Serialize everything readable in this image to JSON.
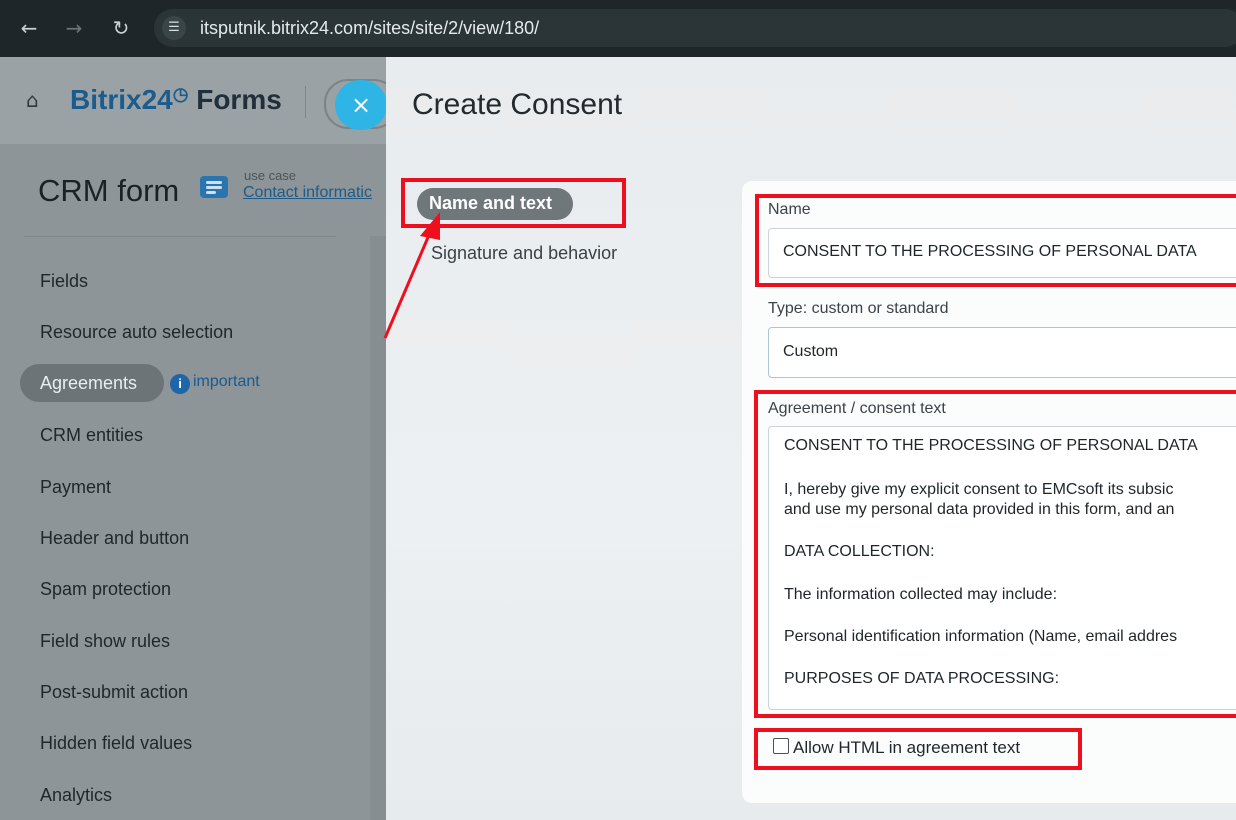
{
  "browser": {
    "back_icon": "arrow-left-icon",
    "forward_icon": "arrow-right-icon",
    "reload_icon": "reload-icon",
    "url": "itsputnik.bitrix24.com/sites/site/2/view/180/"
  },
  "app": {
    "brand_prefix": "Bitrix24",
    "brand_clock": "◷",
    "brand_suffix": " Forms",
    "close_symbol": "×"
  },
  "form": {
    "title": "CRM form",
    "use_case_label": "use case",
    "use_case_value": "Contact informatic"
  },
  "sidebar": {
    "items": [
      {
        "label": "Fields"
      },
      {
        "label": "Resource auto selection"
      },
      {
        "label": "Agreements"
      },
      {
        "label": "CRM entities"
      },
      {
        "label": "Payment"
      },
      {
        "label": "Header and button"
      },
      {
        "label": "Spam protection"
      },
      {
        "label": "Field show rules"
      },
      {
        "label": "Post-submit action"
      },
      {
        "label": "Hidden field values"
      },
      {
        "label": "Analytics"
      }
    ],
    "active_badge_icon": "i",
    "active_badge_text": "important"
  },
  "modal": {
    "title": "Create Consent",
    "tabs": [
      {
        "label": "Name and text"
      },
      {
        "label": "Signature and behavior"
      }
    ],
    "name_label": "Name",
    "name_value": "CONSENT TO THE PROCESSING OF PERSONAL DATA",
    "type_label": "Type: custom or standard",
    "type_value": "Custom",
    "agreement_label": "Agreement / consent text",
    "agreement_lines": [
      "CONSENT TO THE PROCESSING OF PERSONAL DATA",
      "I, hereby give my explicit consent to EMCsoft its subsic",
      "and use my personal data provided in this form, and an",
      "DATA COLLECTION:",
      "The information collected may include:",
      "Personal identification information (Name, email addres",
      "PURPOSES OF DATA PROCESSING:"
    ],
    "allow_html_label": "Allow HTML in agreement text",
    "allow_html_checked": false
  },
  "colors": {
    "annotation": "#ee0f1e",
    "close_button": "#2fb4e6",
    "brand": "#1c5c8c"
  }
}
